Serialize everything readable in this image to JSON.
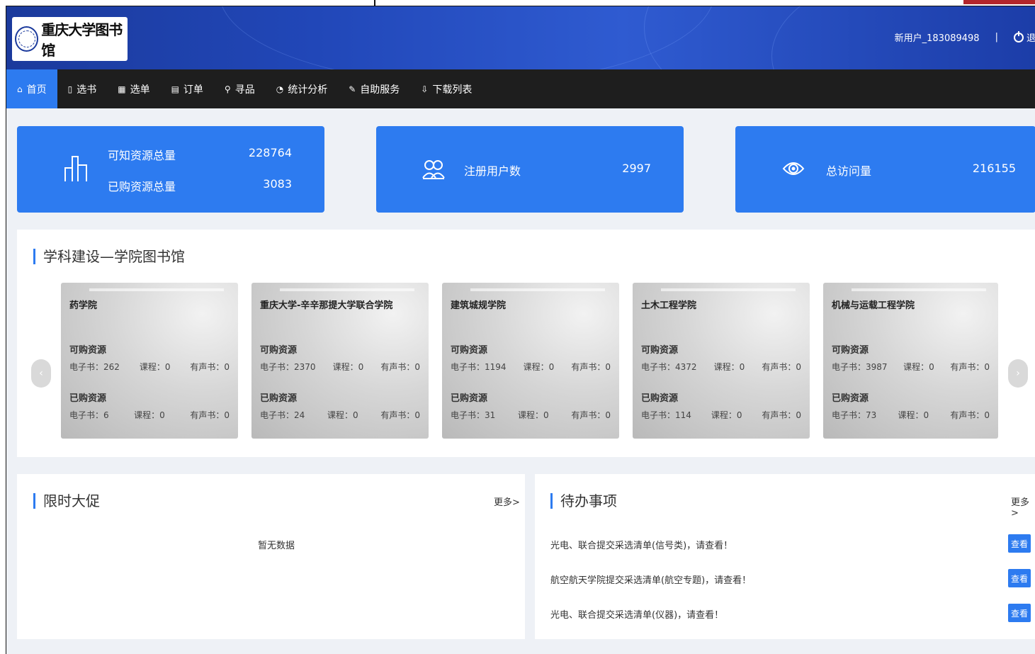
{
  "header": {
    "logo_text": "重庆大学图书馆",
    "user_name": "新用户_183089498",
    "separator": "|",
    "logout_label": "退"
  },
  "nav": [
    {
      "icon": "home-icon",
      "glyph": "⌂",
      "label": "首页"
    },
    {
      "icon": "book-icon",
      "glyph": "▯",
      "label": "选书"
    },
    {
      "icon": "grid-icon",
      "glyph": "▦",
      "label": "选单"
    },
    {
      "icon": "order-icon",
      "glyph": "▤",
      "label": "订单"
    },
    {
      "icon": "search-icon",
      "glyph": "⚲",
      "label": "寻品"
    },
    {
      "icon": "chart-icon",
      "glyph": "◔",
      "label": "统计分析"
    },
    {
      "icon": "edit-icon",
      "glyph": "✎",
      "label": "自助服务"
    },
    {
      "icon": "download-icon",
      "glyph": "⇩",
      "label": "下载列表"
    }
  ],
  "stats": {
    "resources_label": "可知资源总量",
    "resources_value": "228764",
    "purchased_label": "已购资源总量",
    "purchased_value": "3083",
    "users_label": "注册用户数",
    "users_value": "2997",
    "visits_label": "总访问量",
    "visits_value": "216155"
  },
  "colleges_section": {
    "title": "学科建设—学院图书馆",
    "available_label": "可购资源",
    "purchased_label": "已购资源",
    "prev": "‹",
    "next": "›",
    "cards": [
      {
        "name": "药学院",
        "avail": [
          "电子书：262",
          "课程：0",
          "有声书：0"
        ],
        "bought": [
          "电子书：6",
          "课程：0",
          "有声书：0"
        ]
      },
      {
        "name": "重庆大学-辛辛那提大学联合学院",
        "avail": [
          "电子书：2370",
          "课程：0",
          "有声书：0"
        ],
        "bought": [
          "电子书：24",
          "课程：0",
          "有声书：0"
        ]
      },
      {
        "name": "建筑城规学院",
        "avail": [
          "电子书：1194",
          "课程：0",
          "有声书：0"
        ],
        "bought": [
          "电子书：31",
          "课程：0",
          "有声书：0"
        ]
      },
      {
        "name": "土木工程学院",
        "avail": [
          "电子书：4372",
          "课程：0",
          "有声书：0"
        ],
        "bought": [
          "电子书：114",
          "课程：0",
          "有声书：0"
        ]
      },
      {
        "name": "机械与运载工程学院",
        "avail": [
          "电子书：3987",
          "课程：0",
          "有声书：0"
        ],
        "bought": [
          "电子书：73",
          "课程：0",
          "有声书：0"
        ]
      }
    ]
  },
  "promo": {
    "title": "限时大促",
    "more": "更多>",
    "empty": "暂无数据"
  },
  "todo": {
    "title": "待办事项",
    "more": "更多>",
    "view_label": "查看",
    "items": [
      "光电、联合提交采选清单(信号类)，请查看！",
      "航空航天学院提交采选清单(航空专题)，请查看！",
      "光电、联合提交采选清单(仪器)，请查看！"
    ]
  },
  "colors": {
    "accent": "#2d7bf0",
    "nav_bg": "#1e1e1e",
    "header_bg": "#2147b8"
  }
}
